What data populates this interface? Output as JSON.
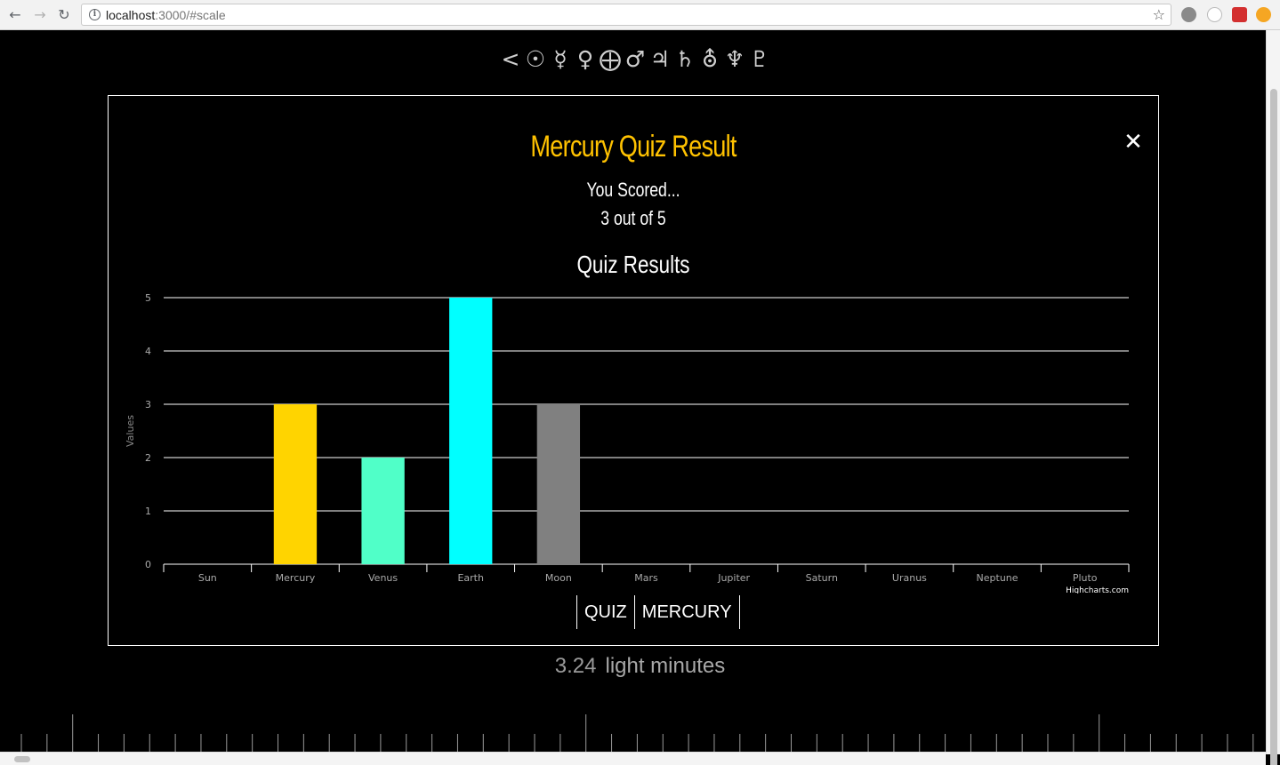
{
  "browser": {
    "url_host": "localhost",
    "url_rest": ":3000/#scale"
  },
  "nav_symbols": [
    "<",
    "☉",
    "☿",
    "♀",
    "⨁",
    "♂",
    "♃",
    "♄",
    "⛢",
    "♆",
    "♇"
  ],
  "modal": {
    "title": "Mercury Quiz Result",
    "close_label": "✕",
    "scored_line1": "You Scored...",
    "scored_line2": "3 out of 5",
    "chart_title": "Quiz Results",
    "credits": "Highcharts.com",
    "buttons": [
      "QUIZ",
      "MERCURY"
    ]
  },
  "distance": {
    "value": "3.24",
    "unit": "light minutes"
  },
  "colors": {
    "accent": "#ffc200",
    "modal_border": "#ffffff"
  },
  "chart_data": {
    "type": "bar",
    "title": "Quiz Results",
    "xlabel": "",
    "ylabel": "Values",
    "ylim": [
      0,
      5
    ],
    "yticks": [
      0,
      1,
      2,
      3,
      4,
      5
    ],
    "grid": true,
    "categories": [
      "Sun",
      "Mercury",
      "Venus",
      "Earth",
      "Moon",
      "Mars",
      "Jupiter",
      "Saturn",
      "Uranus",
      "Neptune",
      "Pluto"
    ],
    "values": [
      0,
      3,
      2,
      5,
      3,
      0,
      0,
      0,
      0,
      0,
      0
    ],
    "bar_colors": [
      "#ffd400",
      "#ffd400",
      "#50ffc8",
      "#00ffff",
      "#808080",
      "#ffd400",
      "#ffd400",
      "#ffd400",
      "#ffd400",
      "#ffd400",
      "#ffd400"
    ]
  }
}
